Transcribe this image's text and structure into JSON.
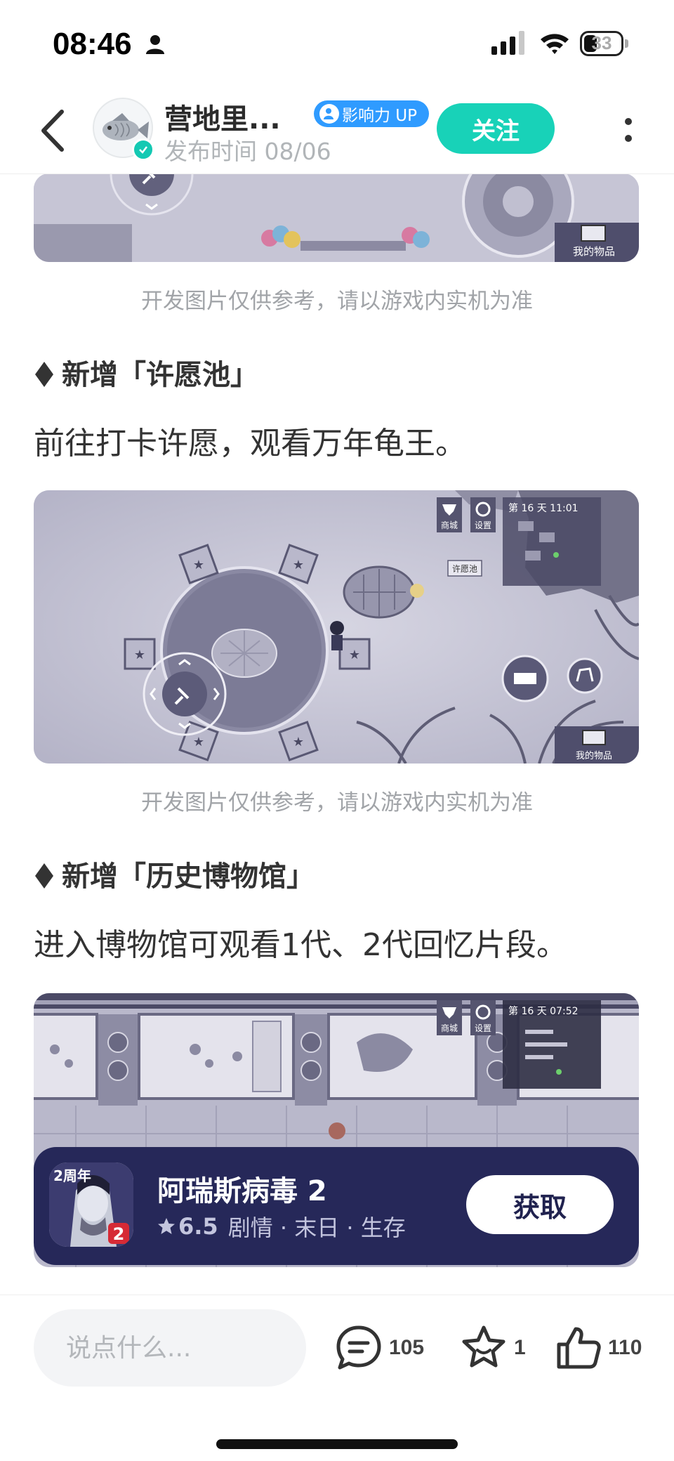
{
  "status_bar": {
    "time": "08:46",
    "battery": "33"
  },
  "header": {
    "author_name": "营地里...",
    "influence_badge": "影响力 UP",
    "publish_time": "发布时间 08/06",
    "follow_label": "关注"
  },
  "article": {
    "image_1": {
      "hud_label": "我的物品",
      "caption": "开发图片仅供参考，请以游戏内实机为准"
    },
    "section_1": {
      "heading": "新增「许愿池」",
      "text": "前往打卡许愿，观看万年龟王。"
    },
    "image_2": {
      "hud_shop": "商城",
      "hud_settings": "设置",
      "hud_time": "第 16 天  11:01",
      "hud_items": "我的物品",
      "wish_pool_tag": "许愿池",
      "caption": "开发图片仅供参考，请以游戏内实机为准"
    },
    "section_2": {
      "heading": "新增「历史博物馆」",
      "text": "进入博物馆可观看1代、2代回忆片段。"
    },
    "image_3": {
      "hud_shop": "商城",
      "hud_settings": "设置",
      "hud_time": "第 16 天  07:52"
    }
  },
  "app_card": {
    "icon_badge": "2周年",
    "icon_number": "2",
    "name": "阿瑞斯病毒 2",
    "rating": "6.5",
    "tags": "剧情 · 末日 · 生存",
    "get_label": "获取"
  },
  "bottom_bar": {
    "comment_placeholder": "说点什么...",
    "comment_count": "105",
    "favorite_count": "1",
    "like_count": "110"
  },
  "colors": {
    "accent": "#18d2b8",
    "influence_badge": "#2f9bff",
    "app_card_bg": "#262859"
  }
}
